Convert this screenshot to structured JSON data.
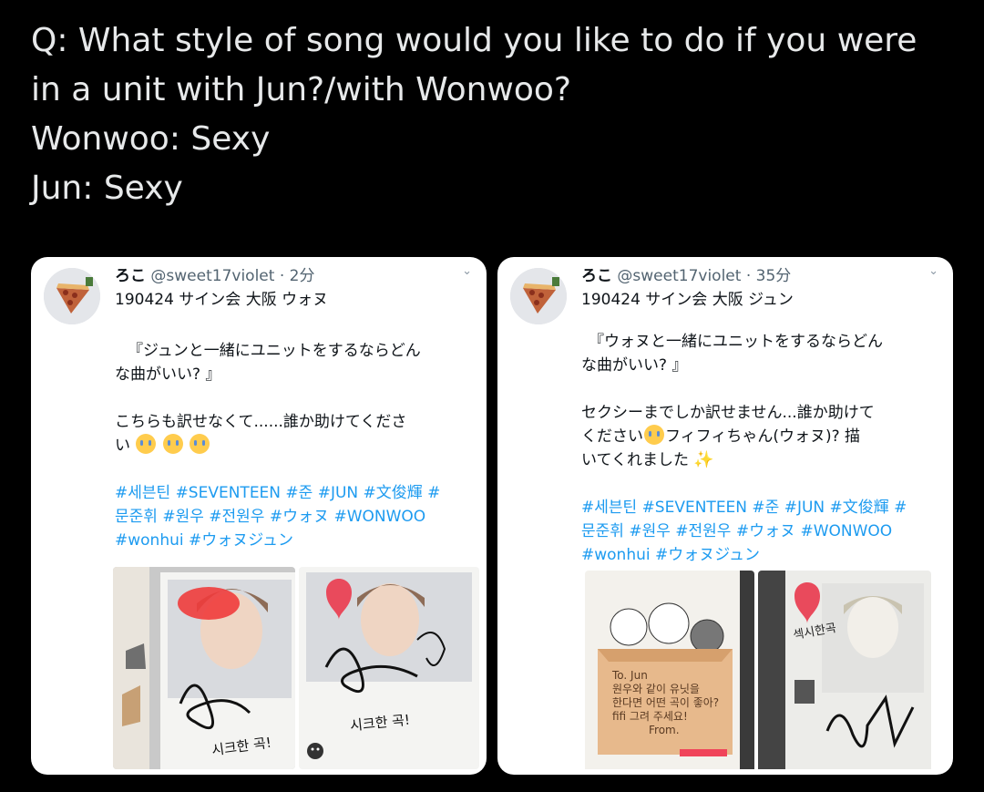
{
  "caption": {
    "line1": "Q: What style of song would you like to do if you were",
    "line2": "in a unit with Jun?/with Wonwoo?",
    "line3": "Wonwoo: Sexy",
    "line4": "Jun: Sexy"
  },
  "left_tweet": {
    "name": "ろこ",
    "handle": "@sweet17violet",
    "time": "· 2分",
    "title": "190424 サイン会 大阪 ウォヌ",
    "quote_line1": "『ジュンと一緒にユニットをするならどん",
    "quote_line2": "な曲がいい? 』",
    "text_line1": "こちらも訳せなくて......誰か助けてくださ",
    "text_line2": "い",
    "tags_line1": "#세븐틴 #SEVENTEEN #준 #JUN #文俊輝 #",
    "tags_line2": "문준휘 #원우 #전원우 #ウォヌ #WONWOO",
    "tags_line3": "#wonhui #ウォヌジュン",
    "photo1_text": "시크한 곡!",
    "photo2_text": "시크한 곡!"
  },
  "right_tweet": {
    "name": "ろこ",
    "handle": "@sweet17violet",
    "time": "· 35分",
    "title": "190424 サイン会 大阪 ジュン",
    "quote_line1": "『ウォヌと一緒にユニットをするならどん",
    "quote_line2": "な曲がいい? 』",
    "text_line1": "セクシーまでしか訳せません...誰か助けて",
    "text_line2a": "ください",
    "text_line2b": "フィフィちゃん(ウォヌ)? 描",
    "text_line3": "いてくれました",
    "tags_line1": "#세븐틴 #SEVENTEEN #준 #JUN #文俊輝 #",
    "tags_line2": "문준휘 #원우 #전원우 #ウォヌ #WONWOO",
    "tags_line3": "#wonhui #ウォヌジュン",
    "note_to": "To. Jun",
    "note_line1": "원우와 같이 유닛을",
    "note_line2": "한다면 어떤 곡이 좋아?",
    "note_line3": "fifi 그려 주세요!",
    "note_from": "From.",
    "side_text": "섹시한곡"
  },
  "icons": [
    "chevron-down-icon",
    "loudly-crying-emoji",
    "sparkles-emoji",
    "pizza-avatar"
  ],
  "colors": {
    "hashtag": "#1d9bf0",
    "handle": "#536471",
    "background": "#000000",
    "card": "#ffffff"
  }
}
